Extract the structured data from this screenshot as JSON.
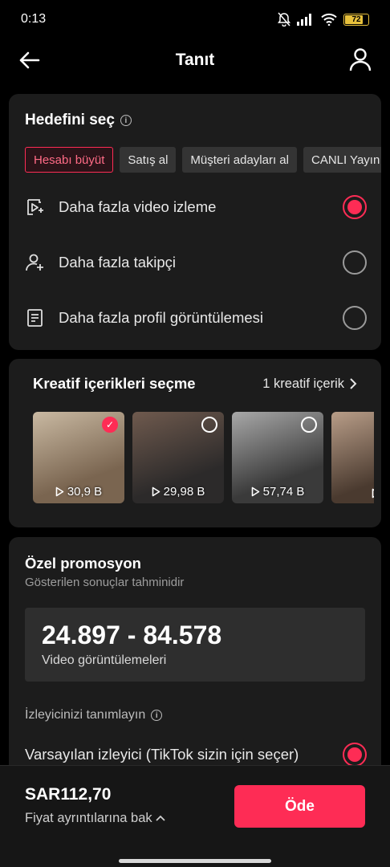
{
  "status_bar": {
    "time": "0:13",
    "battery": "72",
    "battery_level": 0.72,
    "icons": [
      "bell-muted-icon",
      "signal-icon",
      "wifi-icon",
      "battery-icon"
    ]
  },
  "nav": {
    "title": "Tanıt",
    "icons": [
      "back-arrow-icon",
      "profile-icon"
    ]
  },
  "goal": {
    "title": "Hedefini seç",
    "chips": [
      {
        "label": "Hesabı büyüt",
        "active": true
      },
      {
        "label": "Satış al",
        "active": false
      },
      {
        "label": "Müşteri adayları al",
        "active": false
      },
      {
        "label": "CANLI Yayın",
        "active": false
      }
    ],
    "options": [
      {
        "label": "Daha fazla video izleme",
        "icon": "video-play-icon",
        "selected": true
      },
      {
        "label": "Daha fazla takipçi",
        "icon": "add-person-icon",
        "selected": false
      },
      {
        "label": "Daha fazla profil görüntülemesi",
        "icon": "profile-page-icon",
        "selected": false
      }
    ]
  },
  "creative": {
    "title": "Kreatif içerikleri seçme",
    "link_label": "1 kreatif içerik",
    "videos": [
      {
        "views": "30,9 B",
        "selected": true,
        "colors": [
          "#7a6550",
          "#c9b9a2"
        ]
      },
      {
        "views": "29,98 B",
        "selected": false,
        "colors": [
          "#2c2a2a",
          "#6f5a4e"
        ]
      },
      {
        "views": "57,74 B",
        "selected": false,
        "colors": [
          "#3a3a3a",
          "#a8a8a8"
        ]
      },
      {
        "views": "",
        "selected": false,
        "colors": [
          "#4a3a2f",
          "#b89d88"
        ]
      }
    ]
  },
  "promo": {
    "title": "Özel promosyon",
    "subtitle": "Gösterilen sonuçlar tahminidir",
    "estimate_range": "24.897 - 84.578",
    "estimate_label": "Video görüntülemeleri",
    "audience_title": "İzleyicinizi tanımlayın",
    "audience_option": "Varsayılan izleyici (TikTok sizin için seçer)",
    "audience_selected": true
  },
  "footer": {
    "price": "SAR112,70",
    "price_details": "Fiyat ayrıntılarına bak",
    "pay_label": "Öde"
  },
  "colors": {
    "accent": "#fe2c55",
    "card": "#1c1c1c",
    "background": "#000000"
  }
}
